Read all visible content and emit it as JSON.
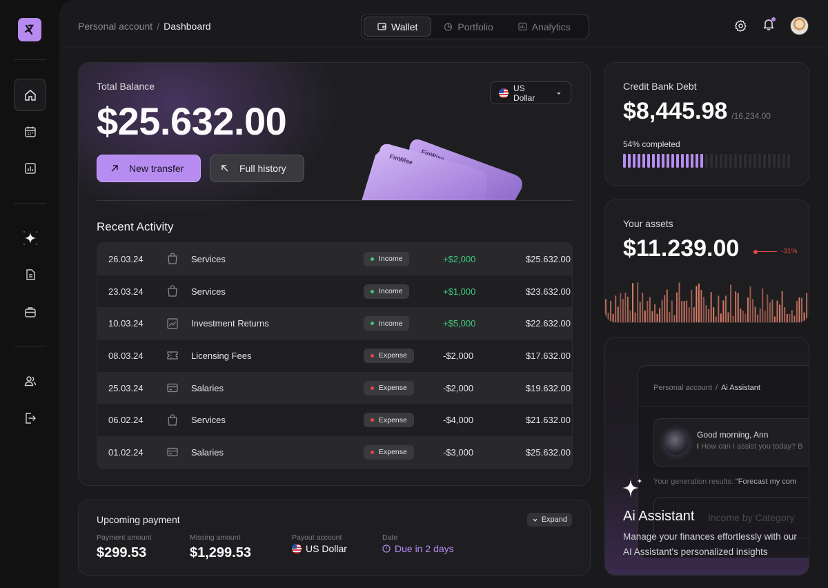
{
  "sidebar": {
    "logo_icon": "logo-icon",
    "items": [
      {
        "name": "home",
        "icon": "home-icon",
        "active": true
      },
      {
        "name": "calendar",
        "icon": "calendar-icon"
      },
      {
        "name": "chart",
        "icon": "bar-chart-icon"
      },
      {
        "name": "ai",
        "icon": "sparkle-icon"
      },
      {
        "name": "documents",
        "icon": "document-icon"
      },
      {
        "name": "briefcase",
        "icon": "briefcase-icon"
      },
      {
        "name": "users",
        "icon": "users-icon"
      },
      {
        "name": "logout",
        "icon": "logout-icon"
      }
    ]
  },
  "header": {
    "breadcrumb_root": "Personal account",
    "breadcrumb_sep": "/",
    "breadcrumb_current": "Dashboard",
    "tabs": [
      {
        "label": "Wallet",
        "icon": "wallet-icon",
        "active": true
      },
      {
        "label": "Portfolio",
        "icon": "pie-chart-icon",
        "active": false
      },
      {
        "label": "Analytics",
        "icon": "analytics-icon",
        "active": false
      }
    ]
  },
  "balance": {
    "label": "Total Balance",
    "amount": "$25.632.00",
    "currency": "US Dollar",
    "new_transfer": "New transfer",
    "full_history": "Full history",
    "card_brand": "FinWise"
  },
  "activity": {
    "title": "Recent Activity",
    "rows": [
      {
        "date": "26.03.24",
        "icon": "shopping-bag-icon",
        "name": "Services",
        "type": "Income",
        "amount": "+$2,000",
        "balance": "$25.632.00"
      },
      {
        "date": "23.03.24",
        "icon": "shopping-bag-icon",
        "name": "Services",
        "type": "Income",
        "amount": "+$1,000",
        "balance": "$23.632.00"
      },
      {
        "date": "10.03.24",
        "icon": "trend-chart-icon",
        "name": "Investment Returns",
        "type": "Income",
        "amount": "+$5,000",
        "balance": "$22.632.00"
      },
      {
        "date": "08.03.24",
        "icon": "ticket-icon",
        "name": "Licensing Fees",
        "type": "Expense",
        "amount": "-$2,000",
        "balance": "$17.632.00"
      },
      {
        "date": "25.03.24",
        "icon": "card-icon",
        "name": "Salaries",
        "type": "Expense",
        "amount": "-$2,000",
        "balance": "$19.632.00"
      },
      {
        "date": "06.02.24",
        "icon": "shopping-bag-icon",
        "name": "Services",
        "type": "Expense",
        "amount": "-$4,000",
        "balance": "$21.632.00"
      },
      {
        "date": "01.02.24",
        "icon": "card-icon",
        "name": "Salaries",
        "type": "Expense",
        "amount": "-$3,000",
        "balance": "$25.632.00"
      }
    ]
  },
  "upcoming": {
    "title": "Upcoming payment",
    "expand": "Expand",
    "payment_label": "Payment amount",
    "payment_value": "$299.53",
    "missing_label": "Missing amount",
    "missing_value": "$1,299.53",
    "account_label": "Payout account",
    "account_value": "US Dollar",
    "date_label": "Date",
    "date_value": "Due in 2 days"
  },
  "credit": {
    "title": "Credit Bank Debt",
    "amount": "$8,445.98",
    "total": "/16,234.00",
    "progress_label": "54% completed",
    "progress": 0.54
  },
  "assets": {
    "title": "Your assets",
    "amount": "$11.239.00",
    "change": "-31%"
  },
  "ai": {
    "crumb_root": "Personal account",
    "crumb_sep": "/",
    "crumb_current": "Ai Assistant",
    "greeting": "Good morning, Ann",
    "prompt": "How can I assist you today? B",
    "gen_label": "Your generation results:",
    "gen_query": "\"Forecast my com",
    "category": "Income by Category",
    "title": "Ai Assistant",
    "description": "Manage your finances effortlessly with our AI Assistant's personalized insights"
  },
  "colors": {
    "accent": "#b68cf1",
    "income": "#3fc97d",
    "expense": "#e54848",
    "assets_bar": "#e07f68"
  }
}
